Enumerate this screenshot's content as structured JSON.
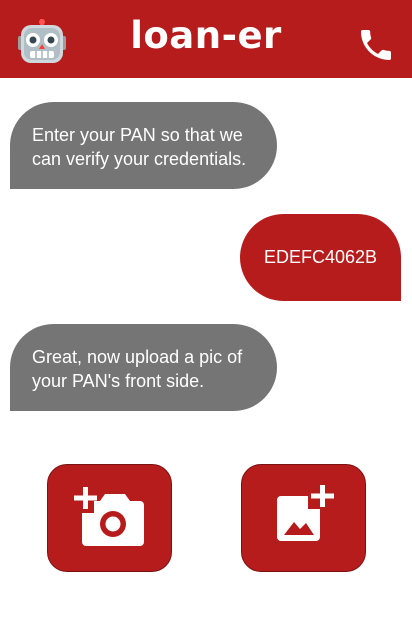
{
  "header": {
    "title": "loan-er",
    "left_icon": "robot-icon",
    "right_icon": "phone-icon",
    "background_color": "#b71c1c"
  },
  "messages": [
    {
      "sender": "bot",
      "text": "Enter your PAN so that we can verify your credentials."
    },
    {
      "sender": "user",
      "text": "EDEFC4062B"
    },
    {
      "sender": "bot",
      "text": "Great, now upload a pic of your PAN's front side."
    }
  ],
  "actions": [
    {
      "icon": "add-camera-icon"
    },
    {
      "icon": "add-photo-icon"
    }
  ],
  "colors": {
    "accent": "#b71c1c",
    "bot_bubble": "#757575",
    "text_on_bubble": "#ffffff"
  }
}
